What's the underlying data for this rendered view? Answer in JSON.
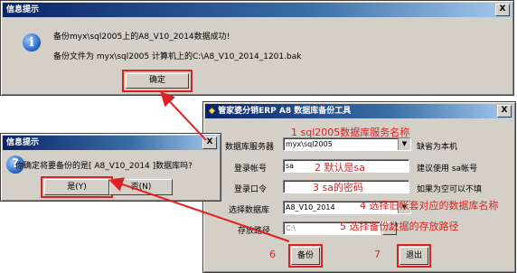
{
  "dialog_success": {
    "title": "信息提示",
    "close_label": "X",
    "icon": "info-icon",
    "line1": "备份myx\\sql2005上的A8_V10_2014数据成功!",
    "line2": "备份文件为 myx\\sql2005 计算机上的C:\\A8_V10_2014_1201.bak",
    "ok_label": "确定"
  },
  "dialog_confirm": {
    "title": "信息提示",
    "close_label": "X",
    "icon": "question-icon",
    "message": "你确定将要备份的是[ A8_V10_2014 ]数据库吗?",
    "yes_label": "是(Y)",
    "no_label": "否(N)"
  },
  "backup_tool": {
    "title": "管家婆分销ERP A8 数据库备份工具",
    "close_label": "X",
    "server_label": "数据库服务器",
    "server_value": "myx\\sql2005",
    "server_hint": "缺省为本机",
    "account_label": "登录帐号",
    "account_value": "sa",
    "account_hint": "建议使用 sa帐号",
    "password_label": "登录口令",
    "password_value": "",
    "password_hint": "如果为空可以不填",
    "db_label": "选择数据库",
    "db_value": "A8_V10_2014",
    "path_label": "存放路径",
    "path_value": "C:\\",
    "backup_label": "备份",
    "exit_label": "退出"
  },
  "annotations": {
    "a1": "1 sql2005数据库服务名称",
    "a2": "2 默认是sa",
    "a3": "3 sa的密码",
    "a4": "4 选择旧帐套对应的数据库名称",
    "a5": "5 选择备份数据的存放路径",
    "a6": "6",
    "a7": "7"
  },
  "colors": {
    "annotation": "#e02020",
    "titlebar": "#0a246a",
    "dialog_bg": "#d4d0c8"
  }
}
